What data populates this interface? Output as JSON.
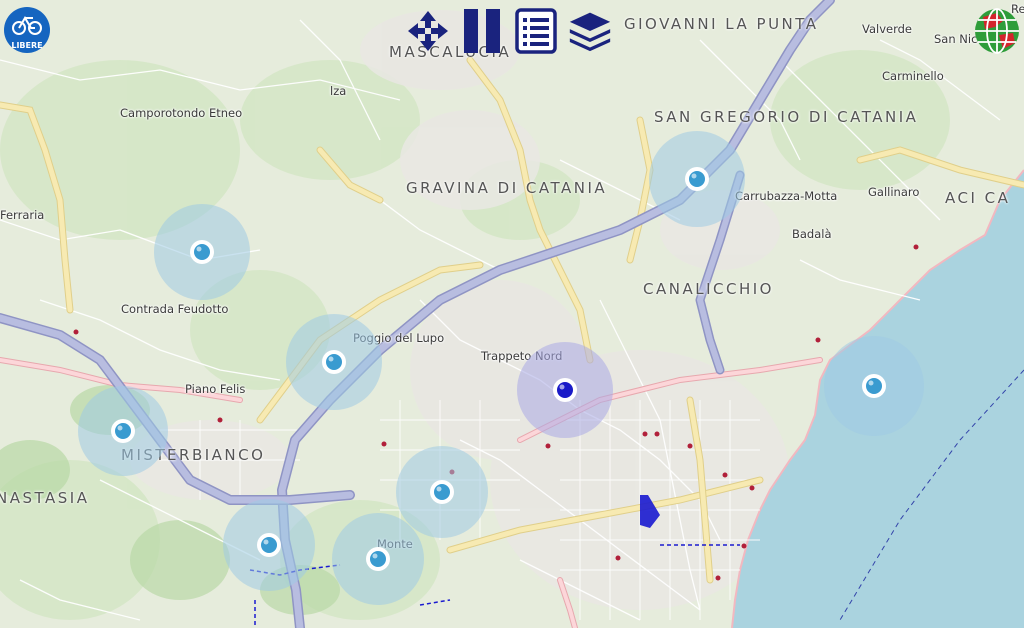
{
  "toolbar": {
    "buttons": [
      {
        "icon": "move-arrows-icon"
      },
      {
        "icon": "pause-icon"
      },
      {
        "icon": "list-icon"
      },
      {
        "icon": "layers-icon"
      }
    ],
    "color": "#1a237e"
  },
  "logo": {
    "text": "LIBERE",
    "icon": "bicycle-icon",
    "color": "#1565c0"
  },
  "globe": {
    "icon": "globe-icon"
  },
  "map": {
    "sea_color": "#aad3df",
    "land_color": "#e4ecd9",
    "urban_color": "#ececec",
    "motorway_color": "#b8bde0",
    "trunk_color": "#f5e7a9"
  },
  "labels": [
    {
      "id": "mascalucia",
      "text": "MASCALUCIA",
      "big": true
    },
    {
      "id": "giovanni",
      "text": "GIOVANNI LA PUNTA",
      "big": true
    },
    {
      "id": "valverde",
      "text": "Valverde"
    },
    {
      "id": "san-nicolo",
      "text": "San Nicolò"
    },
    {
      "id": "re",
      "text": "Re"
    },
    {
      "id": "carminello",
      "text": "Carminello"
    },
    {
      "id": "camporotondo",
      "text": "Camporotondo Etneo"
    },
    {
      "id": "sangregorio",
      "text": "SAN GREGORIO DI CATANIA",
      "big": true
    },
    {
      "id": "gravina",
      "text": "GRAVINA DI CATANIA",
      "big": true
    },
    {
      "id": "carrubazza",
      "text": "Carrubazza-Motta"
    },
    {
      "id": "gallinaro",
      "text": "Gallinaro"
    },
    {
      "id": "aci",
      "text": "ACI CA",
      "big": true
    },
    {
      "id": "ferraria",
      "text": "Ferraria"
    },
    {
      "id": "badala",
      "text": "Badalà"
    },
    {
      "id": "canalicchio",
      "text": "CANALICCHIO",
      "big": true
    },
    {
      "id": "feudotto",
      "text": "Contrada Feudotto"
    },
    {
      "id": "poggio",
      "text": "Poggio del Lupo"
    },
    {
      "id": "trappeto",
      "text": "Trappeto Nord"
    },
    {
      "id": "pianofelis",
      "text": "Piano Felis"
    },
    {
      "id": "misterbianco",
      "text": "MISTERBIANCO",
      "big": true
    },
    {
      "id": "nastasia",
      "text": "NASTASIA",
      "big": true
    },
    {
      "id": "monte",
      "text": "Monte"
    },
    {
      "id": "lza",
      "text": "lza"
    }
  ],
  "markers": [
    {
      "id": "station-1",
      "color": "#3a9bd0",
      "halo": "#9fcbe3"
    },
    {
      "id": "station-2",
      "color": "#3a9bd0",
      "halo": "#9fcbe3"
    },
    {
      "id": "station-3",
      "color": "#3a9bd0",
      "halo": "#9fcbe3"
    },
    {
      "id": "station-4",
      "color": "#3a9bd0",
      "halo": "#9fcbe3"
    },
    {
      "id": "station-5",
      "color": "#3a9bd0",
      "halo": "#9fcbe3"
    },
    {
      "id": "station-6",
      "color": "#3a9bd0",
      "halo": "#9fcbe3"
    },
    {
      "id": "station-7",
      "color": "#3a9bd0",
      "halo": "#9fcbe3"
    },
    {
      "id": "station-8",
      "color": "#3a9bd0",
      "halo": "#9fcbe3"
    },
    {
      "id": "station-selected",
      "color": "#1a1ac8",
      "halo": "#a9a9e6"
    },
    {
      "id": "station-sea",
      "color": "#3a9bd0",
      "halo": "#9fcbe3"
    }
  ]
}
